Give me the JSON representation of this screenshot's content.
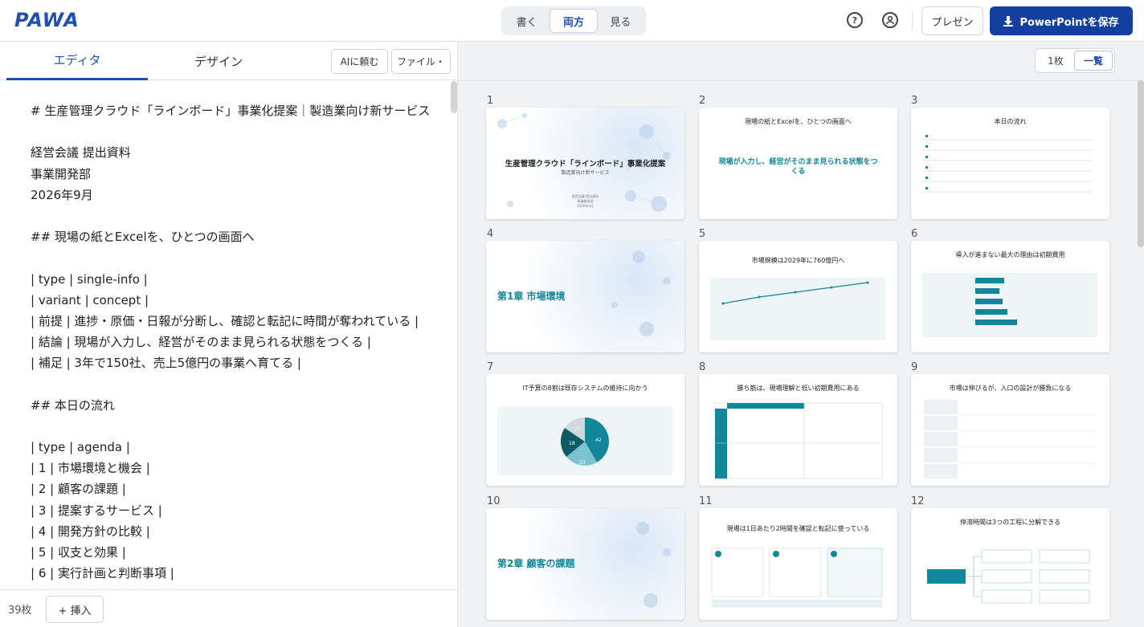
{
  "app": {
    "logo": "PAWA"
  },
  "topbar": {
    "modes": [
      "書く",
      "両方",
      "見る"
    ],
    "active_mode": "両方",
    "help_icon": "help-circle-icon",
    "account_icon": "account-circle-icon",
    "present_label": "プレゼン",
    "save_label": "PowerPointを保存"
  },
  "editor_panel": {
    "tabs": [
      "エディタ",
      "デザイン"
    ],
    "active_tab": "エディタ",
    "ai_button": "AIに頼む",
    "file_button": "ファイル・",
    "lines": [
      "# 生産管理クラウド「ラインボード」事業化提案｜製造業向け新サービス",
      "",
      "経営会議 提出資料",
      "事業開発部",
      "2026年9月",
      "",
      "## 現場の紙とExcelを、ひとつの画面へ",
      "",
      "| type | single-info |",
      "| variant | concept |",
      "| 前提 | 進捗・原価・日報が分断し、確認と転記に時間が奪われている |",
      "| 結論 | 現場が入力し、経営がそのまま見られる状態をつくる |",
      "| 補足 | 3年で150社、売上5億円の事業へ育てる |",
      "",
      "## 本日の流れ",
      "",
      "| type | agenda |",
      "| 1 | 市場環境と機会 |",
      "| 2 | 顧客の課題 |",
      "| 3 | 提案するサービス |",
      "| 4 | 開発方針の比較 |",
      "| 5 | 収支と効果 |",
      "| 6 | 実行計画と判断事項 |"
    ],
    "slide_count": "39枚",
    "insert_button": "+ 挿入"
  },
  "preview_panel": {
    "view_options": [
      "1枚",
      "一覧"
    ],
    "active_view": "一覧",
    "slides": [
      {
        "num": "1",
        "title": "生産管理クラウド「ラインボード」事業化提案",
        "subtitle": "製造業向け新サービス"
      },
      {
        "num": "2",
        "title": "現場の紙とExcelを、ひとつの画面へ",
        "headline": "現場が入力し、経営がそのまま見られる状態をつくる"
      },
      {
        "num": "3",
        "title": "本日の流れ"
      },
      {
        "num": "4",
        "title": "第1章 市場環境"
      },
      {
        "num": "5",
        "title": "市場規模は2029年に760億円へ"
      },
      {
        "num": "6",
        "title": "導入が進まない最大の理由は初期費用"
      },
      {
        "num": "7",
        "title": "IT予算の8割は既存システムの維持に向かう"
      },
      {
        "num": "8",
        "title": "勝ち筋は、現場理解と低い初期費用にある"
      },
      {
        "num": "9",
        "title": "市場は伸びるが、入口の設計が勝負になる"
      },
      {
        "num": "10",
        "title": "第2章 顧客の課題"
      },
      {
        "num": "11",
        "title": "現場は1日あたり2時間を確認と転記に使っている"
      },
      {
        "num": "12",
        "title": "停滞時間は3つの工程に分解できる"
      }
    ],
    "slide7_pie": {
      "values": [
        "42",
        "23",
        "18",
        "17"
      ]
    },
    "slide6_bars": {
      "values": [
        "32",
        "27",
        "31",
        "36",
        "46"
      ]
    },
    "colors": {
      "accent": "#12879a",
      "brand": "#1340a0"
    }
  }
}
